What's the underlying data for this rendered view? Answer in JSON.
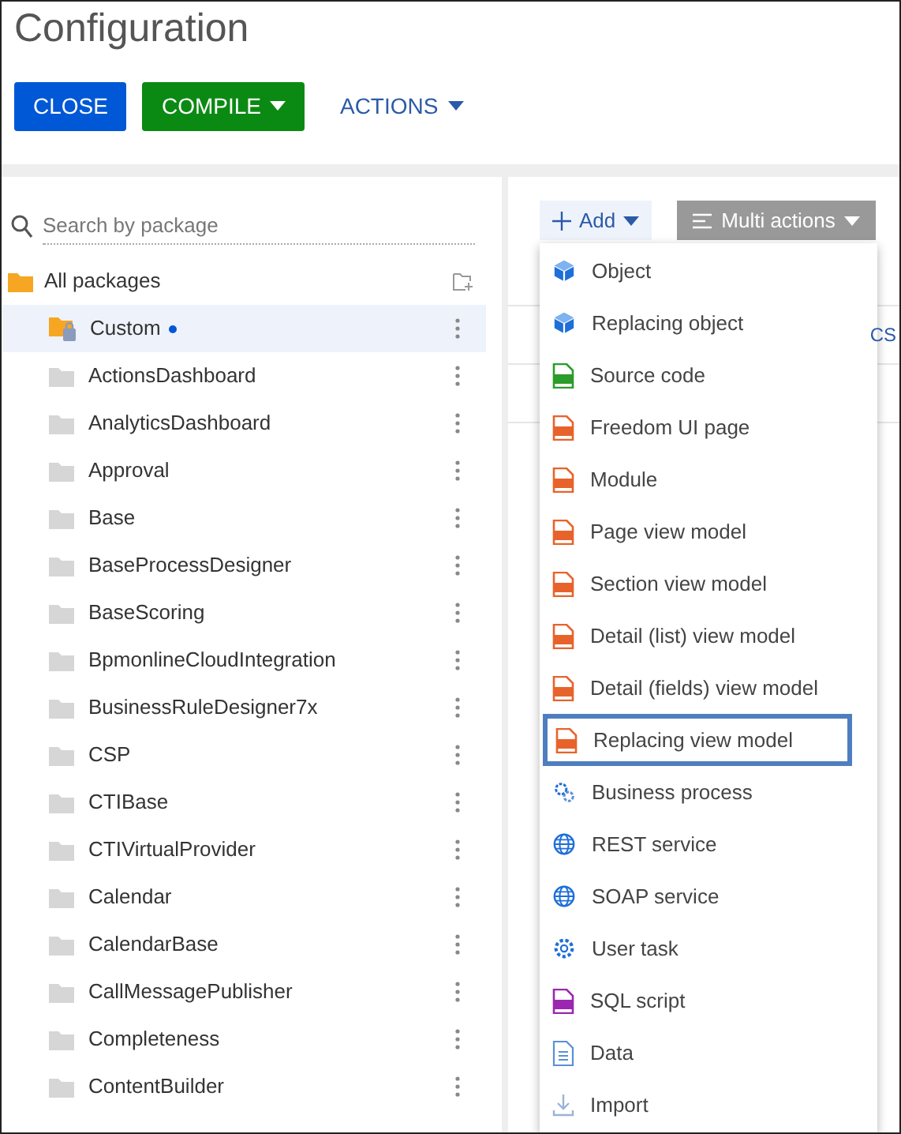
{
  "title": "Configuration",
  "toolbar": [
    {
      "label": "CLOSE",
      "kind": "primary",
      "dropdown": false
    },
    {
      "label": "COMPILE",
      "kind": "success",
      "dropdown": true
    },
    {
      "label": "ACTIONS",
      "kind": "link",
      "dropdown": true
    }
  ],
  "search": {
    "placeholder": "Search by package"
  },
  "tree": {
    "label": "All packages",
    "children": [
      {
        "label": "Custom",
        "kind": "custom",
        "selected": true,
        "modified": true
      },
      {
        "label": "ActionsDashboard",
        "kind": "package",
        "selected": false,
        "modified": false
      },
      {
        "label": "AnalyticsDashboard",
        "kind": "package",
        "selected": false,
        "modified": false
      },
      {
        "label": "Approval",
        "kind": "package",
        "selected": false,
        "modified": false
      },
      {
        "label": "Base",
        "kind": "package",
        "selected": false,
        "modified": false
      },
      {
        "label": "BaseProcessDesigner",
        "kind": "package",
        "selected": false,
        "modified": false
      },
      {
        "label": "BaseScoring",
        "kind": "package",
        "selected": false,
        "modified": false
      },
      {
        "label": "BpmonlineCloudIntegration",
        "kind": "package",
        "selected": false,
        "modified": false
      },
      {
        "label": "BusinessRuleDesigner7x",
        "kind": "package",
        "selected": false,
        "modified": false
      },
      {
        "label": "CSP",
        "kind": "package",
        "selected": false,
        "modified": false
      },
      {
        "label": "CTIBase",
        "kind": "package",
        "selected": false,
        "modified": false
      },
      {
        "label": "CTIVirtualProvider",
        "kind": "package",
        "selected": false,
        "modified": false
      },
      {
        "label": "Calendar",
        "kind": "package",
        "selected": false,
        "modified": false
      },
      {
        "label": "CalendarBase",
        "kind": "package",
        "selected": false,
        "modified": false
      },
      {
        "label": "CallMessagePublisher",
        "kind": "package",
        "selected": false,
        "modified": false
      },
      {
        "label": "Completeness",
        "kind": "package",
        "selected": false,
        "modified": false
      },
      {
        "label": "ContentBuilder",
        "kind": "package",
        "selected": false,
        "modified": false
      }
    ]
  },
  "content": {
    "add_button": "Add",
    "multi_actions_button": "Multi actions",
    "column_1": "CS"
  },
  "add_menu": [
    {
      "label": "Object",
      "kind": "object",
      "selected": false
    },
    {
      "label": "Replacing object",
      "kind": "object",
      "selected": false
    },
    {
      "label": "Source code",
      "kind": "csharp",
      "selected": false
    },
    {
      "label": "Freedom UI page",
      "kind": "js",
      "selected": false
    },
    {
      "label": "Module",
      "kind": "js",
      "selected": false
    },
    {
      "label": "Page view model",
      "kind": "js",
      "selected": false
    },
    {
      "label": "Section view model",
      "kind": "js",
      "selected": false
    },
    {
      "label": "Detail (list) view model",
      "kind": "js",
      "selected": false
    },
    {
      "label": "Detail (fields) view model",
      "kind": "js",
      "selected": false
    },
    {
      "label": "Replacing view model",
      "kind": "js",
      "selected": true
    },
    {
      "label": "Business process",
      "kind": "process",
      "selected": false
    },
    {
      "label": "REST service",
      "kind": "web",
      "selected": false
    },
    {
      "label": "SOAP service",
      "kind": "web",
      "selected": false
    },
    {
      "label": "User task",
      "kind": "usertask",
      "selected": false
    },
    {
      "label": "SQL script",
      "kind": "sql",
      "selected": false
    },
    {
      "label": "Data",
      "kind": "data",
      "selected": false
    },
    {
      "label": "Import",
      "kind": "import",
      "selected": false
    }
  ]
}
